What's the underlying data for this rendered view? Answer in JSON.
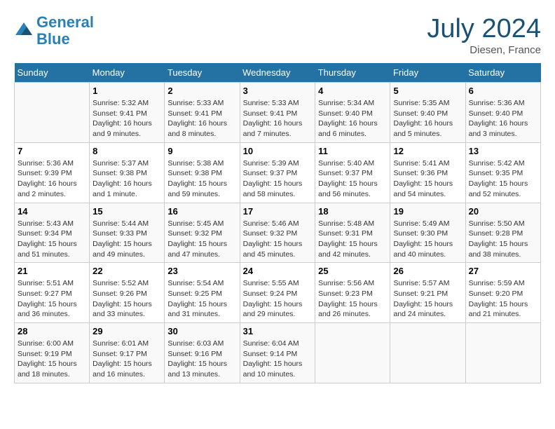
{
  "header": {
    "logo_line1": "General",
    "logo_line2": "Blue",
    "month_year": "July 2024",
    "location": "Diesen, France"
  },
  "days_of_week": [
    "Sunday",
    "Monday",
    "Tuesday",
    "Wednesday",
    "Thursday",
    "Friday",
    "Saturday"
  ],
  "weeks": [
    [
      {
        "num": "",
        "detail": ""
      },
      {
        "num": "1",
        "detail": "Sunrise: 5:32 AM\nSunset: 9:41 PM\nDaylight: 16 hours\nand 9 minutes."
      },
      {
        "num": "2",
        "detail": "Sunrise: 5:33 AM\nSunset: 9:41 PM\nDaylight: 16 hours\nand 8 minutes."
      },
      {
        "num": "3",
        "detail": "Sunrise: 5:33 AM\nSunset: 9:41 PM\nDaylight: 16 hours\nand 7 minutes."
      },
      {
        "num": "4",
        "detail": "Sunrise: 5:34 AM\nSunset: 9:40 PM\nDaylight: 16 hours\nand 6 minutes."
      },
      {
        "num": "5",
        "detail": "Sunrise: 5:35 AM\nSunset: 9:40 PM\nDaylight: 16 hours\nand 5 minutes."
      },
      {
        "num": "6",
        "detail": "Sunrise: 5:36 AM\nSunset: 9:40 PM\nDaylight: 16 hours\nand 3 minutes."
      }
    ],
    [
      {
        "num": "7",
        "detail": "Sunrise: 5:36 AM\nSunset: 9:39 PM\nDaylight: 16 hours\nand 2 minutes."
      },
      {
        "num": "8",
        "detail": "Sunrise: 5:37 AM\nSunset: 9:38 PM\nDaylight: 16 hours\nand 1 minute."
      },
      {
        "num": "9",
        "detail": "Sunrise: 5:38 AM\nSunset: 9:38 PM\nDaylight: 15 hours\nand 59 minutes."
      },
      {
        "num": "10",
        "detail": "Sunrise: 5:39 AM\nSunset: 9:37 PM\nDaylight: 15 hours\nand 58 minutes."
      },
      {
        "num": "11",
        "detail": "Sunrise: 5:40 AM\nSunset: 9:37 PM\nDaylight: 15 hours\nand 56 minutes."
      },
      {
        "num": "12",
        "detail": "Sunrise: 5:41 AM\nSunset: 9:36 PM\nDaylight: 15 hours\nand 54 minutes."
      },
      {
        "num": "13",
        "detail": "Sunrise: 5:42 AM\nSunset: 9:35 PM\nDaylight: 15 hours\nand 52 minutes."
      }
    ],
    [
      {
        "num": "14",
        "detail": "Sunrise: 5:43 AM\nSunset: 9:34 PM\nDaylight: 15 hours\nand 51 minutes."
      },
      {
        "num": "15",
        "detail": "Sunrise: 5:44 AM\nSunset: 9:33 PM\nDaylight: 15 hours\nand 49 minutes."
      },
      {
        "num": "16",
        "detail": "Sunrise: 5:45 AM\nSunset: 9:32 PM\nDaylight: 15 hours\nand 47 minutes."
      },
      {
        "num": "17",
        "detail": "Sunrise: 5:46 AM\nSunset: 9:32 PM\nDaylight: 15 hours\nand 45 minutes."
      },
      {
        "num": "18",
        "detail": "Sunrise: 5:48 AM\nSunset: 9:31 PM\nDaylight: 15 hours\nand 42 minutes."
      },
      {
        "num": "19",
        "detail": "Sunrise: 5:49 AM\nSunset: 9:30 PM\nDaylight: 15 hours\nand 40 minutes."
      },
      {
        "num": "20",
        "detail": "Sunrise: 5:50 AM\nSunset: 9:28 PM\nDaylight: 15 hours\nand 38 minutes."
      }
    ],
    [
      {
        "num": "21",
        "detail": "Sunrise: 5:51 AM\nSunset: 9:27 PM\nDaylight: 15 hours\nand 36 minutes."
      },
      {
        "num": "22",
        "detail": "Sunrise: 5:52 AM\nSunset: 9:26 PM\nDaylight: 15 hours\nand 33 minutes."
      },
      {
        "num": "23",
        "detail": "Sunrise: 5:54 AM\nSunset: 9:25 PM\nDaylight: 15 hours\nand 31 minutes."
      },
      {
        "num": "24",
        "detail": "Sunrise: 5:55 AM\nSunset: 9:24 PM\nDaylight: 15 hours\nand 29 minutes."
      },
      {
        "num": "25",
        "detail": "Sunrise: 5:56 AM\nSunset: 9:23 PM\nDaylight: 15 hours\nand 26 minutes."
      },
      {
        "num": "26",
        "detail": "Sunrise: 5:57 AM\nSunset: 9:21 PM\nDaylight: 15 hours\nand 24 minutes."
      },
      {
        "num": "27",
        "detail": "Sunrise: 5:59 AM\nSunset: 9:20 PM\nDaylight: 15 hours\nand 21 minutes."
      }
    ],
    [
      {
        "num": "28",
        "detail": "Sunrise: 6:00 AM\nSunset: 9:19 PM\nDaylight: 15 hours\nand 18 minutes."
      },
      {
        "num": "29",
        "detail": "Sunrise: 6:01 AM\nSunset: 9:17 PM\nDaylight: 15 hours\nand 16 minutes."
      },
      {
        "num": "30",
        "detail": "Sunrise: 6:03 AM\nSunset: 9:16 PM\nDaylight: 15 hours\nand 13 minutes."
      },
      {
        "num": "31",
        "detail": "Sunrise: 6:04 AM\nSunset: 9:14 PM\nDaylight: 15 hours\nand 10 minutes."
      },
      {
        "num": "",
        "detail": ""
      },
      {
        "num": "",
        "detail": ""
      },
      {
        "num": "",
        "detail": ""
      }
    ]
  ]
}
